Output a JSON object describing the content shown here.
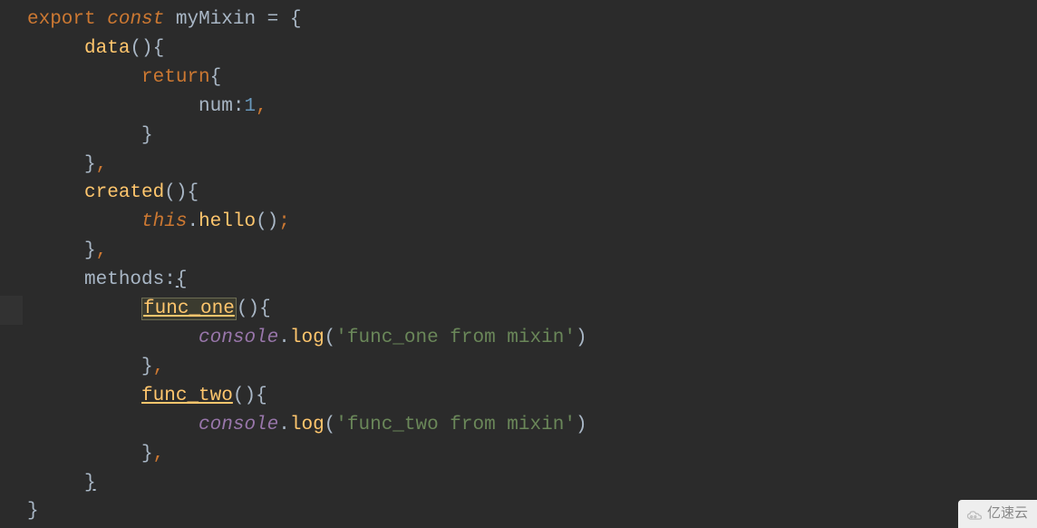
{
  "code": {
    "line1": {
      "export": "export",
      "const": "const",
      "varName": "myMixin",
      "equals": " = ",
      "brace": "{"
    },
    "line2": {
      "indent": "     ",
      "method": "data",
      "parens": "()",
      "brace": "{"
    },
    "line3": {
      "indent": "          ",
      "return": "return",
      "brace": "{"
    },
    "line4": {
      "indent": "               ",
      "key": "num",
      "colon": ":",
      "value": "1",
      "comma": ","
    },
    "line5": {
      "indent": "          ",
      "brace": "}"
    },
    "line6": {
      "indent": "     ",
      "brace": "}",
      "comma": ","
    },
    "line7": {
      "indent": "     ",
      "method": "created",
      "parens": "()",
      "brace": "{"
    },
    "line8": {
      "indent": "          ",
      "this": "this",
      "dot": ".",
      "method": "hello",
      "parens": "()",
      "semicolon": ";"
    },
    "line9": {
      "indent": "     ",
      "brace": "}",
      "comma": ","
    },
    "line10": {
      "indent": "     ",
      "key": "methods",
      "colon": ":",
      "brace": "{"
    },
    "line11": {
      "indent": "          ",
      "method": "func_one",
      "parens": "()",
      "brace": "{"
    },
    "line12": {
      "indent": "               ",
      "console": "console",
      "dot": ".",
      "method": "log",
      "paren_open": "(",
      "string": "'func_one from mixin'",
      "paren_close": ")"
    },
    "line13": {
      "indent": "          ",
      "brace": "}",
      "comma": ","
    },
    "line14": {
      "indent": "          ",
      "method": "func_two",
      "parens": "()",
      "brace": "{"
    },
    "line15": {
      "indent": "               ",
      "console": "console",
      "dot": ".",
      "method": "log",
      "paren_open": "(",
      "string": "'func_two from mixin'",
      "paren_close": ")"
    },
    "line16": {
      "indent": "          ",
      "brace": "}",
      "comma": ","
    },
    "line17": {
      "indent": "     ",
      "brace": "}"
    },
    "line18": {
      "brace": "}"
    }
  },
  "watermark": {
    "text": "亿速云"
  }
}
